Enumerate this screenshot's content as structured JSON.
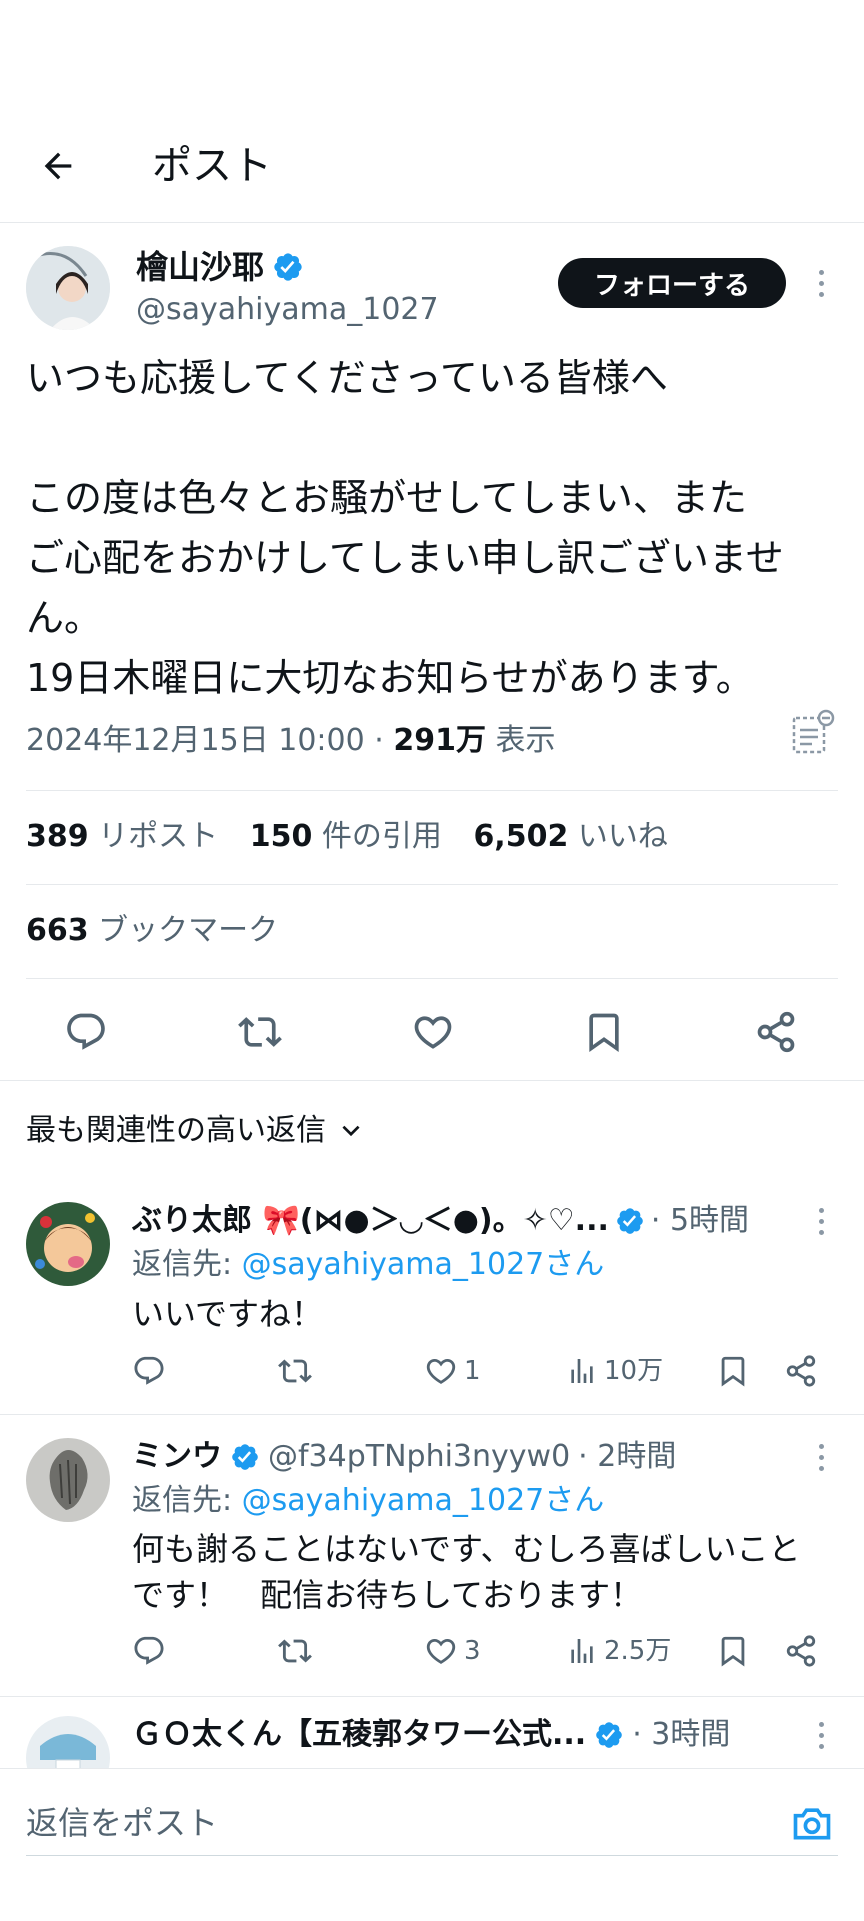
{
  "header": {
    "title": "ポスト"
  },
  "post": {
    "display_name": "檜山沙耶",
    "handle": "@sayahiyama_1027",
    "follow_label": "フォローする",
    "text_lines": [
      "いつも応援してくださっている皆様へ",
      "",
      "この度は色々とお騒がせしてしまい、また",
      "ご心配をおかけしてしまい申し訳ございませ",
      "ん。",
      "19日木曜日に大切なお知らせがあります。"
    ],
    "timestamp": "2024年12月15日 10:00",
    "separator": "·",
    "views_count": "291万",
    "views_label": "表示",
    "stats": {
      "reposts_count": "389",
      "reposts_label": "リポスト",
      "quotes_count": "150",
      "quotes_label": "件の引用",
      "likes_count": "6,502",
      "likes_label": "いいね",
      "bookmarks_count": "663",
      "bookmarks_label": "ブックマーク"
    }
  },
  "replies_sort": {
    "label": "最も関連性の高い返信"
  },
  "replies": [
    {
      "name": "ぶり太郎 🎀(⋈●＞◡＜●)。✧♡...",
      "handle": "",
      "time": "· 5時間",
      "reply_to_prefix": "返信先: ",
      "reply_to_handle": "@sayahiyama_1027さん",
      "text_lines": [
        "いいですね！"
      ],
      "likes": "1",
      "views": "10万"
    },
    {
      "name": "ミンウ",
      "handle": "@f34pTNphi3nyyw0",
      "time": "· 2時間",
      "reply_to_prefix": "返信先: ",
      "reply_to_handle": "@sayahiyama_1027さん",
      "text_lines": [
        "何も謝ることはないです、むしろ喜ばしいこと",
        "です！　配信お待ちしております！"
      ],
      "likes": "3",
      "views": "2.5万"
    },
    {
      "name": "ＧＯ太くん【五稜郭タワー公式...",
      "time": "· 3時間"
    }
  ],
  "composer": {
    "placeholder": "返信をポスト"
  },
  "colors": {
    "accent": "#1d9bf0",
    "text": "#0f1419",
    "muted": "#536471",
    "divider": "#e6e9ec"
  }
}
